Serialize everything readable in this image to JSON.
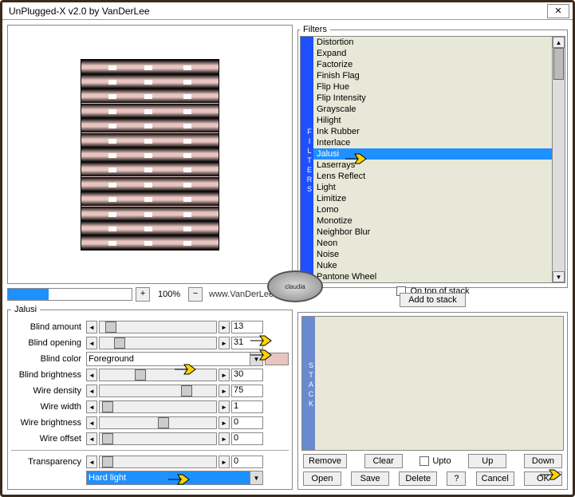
{
  "window": {
    "title": "UnPlugged-X v2.0 by VanDerLee"
  },
  "zoom": {
    "value": "100%",
    "url": "www.VanDerLee.com"
  },
  "filters": {
    "legend": "Filters",
    "tab": "FILTERS",
    "items": [
      "Distortion",
      "Expand",
      "Factorize",
      "Finish Flag",
      "Flip Hue",
      "Flip Intensity",
      "Grayscale",
      "Hilight",
      "Ink Rubber",
      "Interlace",
      "Jalusi",
      "Laserrays",
      "Lens Reflect",
      "Light",
      "Limitize",
      "Lomo",
      "Monotize",
      "Neighbor Blur",
      "Neon",
      "Noise",
      "Nuke",
      "Pantone Wheel"
    ],
    "selected": "Jalusi",
    "ontop_label": "On top of stack",
    "ontop_checked": false
  },
  "buttons": {
    "add": "Add to stack",
    "remove": "Remove",
    "clear": "Clear",
    "upto": "Upto",
    "up": "Up",
    "down": "Down",
    "open": "Open",
    "save": "Save",
    "delete": "Delete",
    "help": "?",
    "cancel": "Cancel",
    "ok": "OK"
  },
  "stack": {
    "tab": "STACK"
  },
  "params": {
    "legend": "Jalusi",
    "rows": [
      {
        "label": "Blind amount",
        "value": "13",
        "thumb": 5
      },
      {
        "label": "Blind opening",
        "value": "31",
        "thumb": 12
      },
      {
        "label": "Blind color",
        "combo": "Foreground"
      },
      {
        "label": "Blind brightness",
        "value": "30",
        "thumb": 30
      },
      {
        "label": "Wire density",
        "value": "75",
        "thumb": 70
      },
      {
        "label": "Wire width",
        "value": "1",
        "thumb": 2
      },
      {
        "label": "Wire brightness",
        "value": "0",
        "thumb": 50
      },
      {
        "label": "Wire offset",
        "value": "0",
        "thumb": 2
      }
    ],
    "transparency": {
      "label": "Transparency",
      "value": "0",
      "thumb": 2
    },
    "blend": "Hard light"
  },
  "watermark": "claudia"
}
